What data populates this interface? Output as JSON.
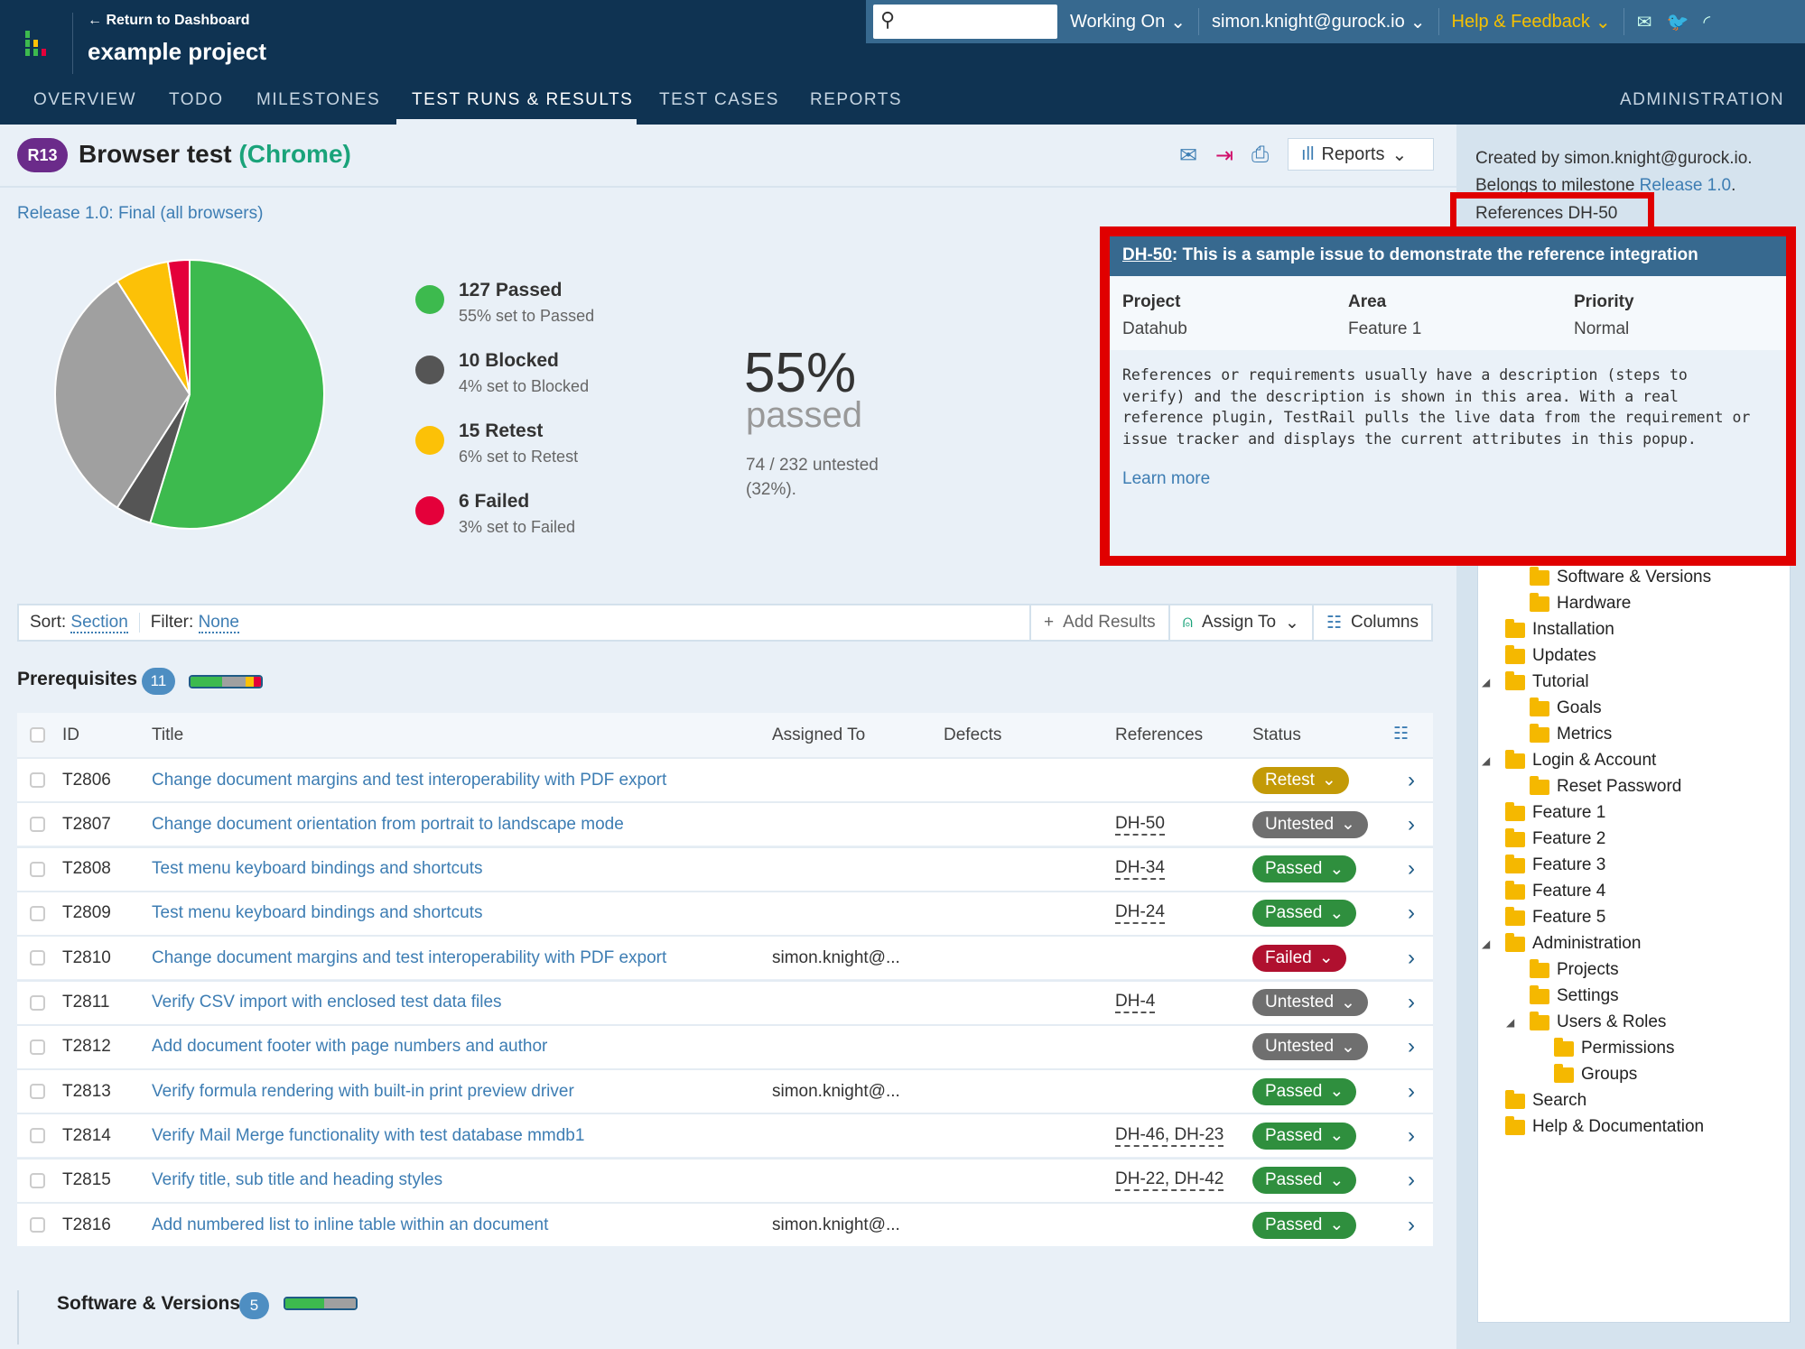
{
  "header": {
    "return_link": "← Return to Dashboard",
    "project": "example project",
    "search_placeholder": "",
    "working_on": "Working On",
    "user": "simon.knight@gurock.io",
    "help": "Help & Feedback"
  },
  "nav": {
    "tabs": [
      "OVERVIEW",
      "TODO",
      "MILESTONES",
      "TEST RUNS & RESULTS",
      "TEST CASES",
      "REPORTS"
    ],
    "active": "TEST RUNS & RESULTS",
    "admin": "ADMINISTRATION"
  },
  "run": {
    "badge": "R13",
    "title": "Browser test",
    "config": "(Chrome)",
    "milestone_link": "Release 1.0: Final (all browsers)",
    "reports_label": "Reports"
  },
  "stats": {
    "items": [
      {
        "title": "127 Passed",
        "sub": "55% set to Passed",
        "color": "#3dba4e",
        "value": 127
      },
      {
        "title": "10 Blocked",
        "sub": "4% set to Blocked",
        "color": "#555555",
        "value": 10
      },
      {
        "title": "15 Retest",
        "sub": "6% set to Retest",
        "color": "#fcc107",
        "value": 15
      },
      {
        "title": "6 Failed",
        "sub": "3% set to Failed",
        "color": "#e4003a",
        "value": 6
      }
    ],
    "untested_value": 74,
    "untested_color": "#a0a0a0",
    "percent": "55%",
    "percent_label": "passed",
    "untested": "74 / 232 untested",
    "untested_pct": "(32%)."
  },
  "toolbar": {
    "sort_label": "Sort:",
    "sort_value": "Section",
    "filter_label": "Filter:",
    "filter_value": "None",
    "add_results": "Add Results",
    "assign_to": "Assign To",
    "columns": "Columns"
  },
  "section": {
    "name": "Prerequisites",
    "count": "11",
    "next_name": "Software & Versions",
    "next_count": "5"
  },
  "table": {
    "headers": [
      "ID",
      "Title",
      "Assigned To",
      "Defects",
      "References",
      "Status"
    ],
    "rows": [
      {
        "id": "T2806",
        "title": "Change document margins and test interoperability with PDF export",
        "assigned": "",
        "refs": "",
        "status": "Retest"
      },
      {
        "id": "T2807",
        "title": "Change document orientation from portrait to landscape mode",
        "assigned": "",
        "refs": "DH-50",
        "status": "Untested"
      },
      {
        "id": "T2808",
        "title": "Test menu keyboard bindings and shortcuts",
        "assigned": "",
        "refs": "DH-34",
        "status": "Passed"
      },
      {
        "id": "T2809",
        "title": "Test menu keyboard bindings and shortcuts",
        "assigned": "",
        "refs": "DH-24",
        "status": "Passed"
      },
      {
        "id": "T2810",
        "title": "Change document margins and test interoperability with PDF export",
        "assigned": "simon.knight@...",
        "refs": "",
        "status": "Failed"
      },
      {
        "id": "T2811",
        "title": "Verify CSV import with enclosed test data files",
        "assigned": "",
        "refs": "DH-4",
        "status": "Untested"
      },
      {
        "id": "T2812",
        "title": "Add document footer with page numbers and author",
        "assigned": "",
        "refs": "",
        "status": "Untested"
      },
      {
        "id": "T2813",
        "title": "Verify formula rendering with built-in print preview driver",
        "assigned": "simon.knight@...",
        "refs": "",
        "status": "Passed"
      },
      {
        "id": "T2814",
        "title": "Verify Mail Merge functionality with test database mmdb1",
        "assigned": "",
        "refs": "DH-46, DH-23",
        "status": "Passed"
      },
      {
        "id": "T2815",
        "title": "Verify title, sub title and heading styles",
        "assigned": "",
        "refs": "DH-22, DH-42",
        "status": "Passed"
      },
      {
        "id": "T2816",
        "title": "Add numbered list to inline table within an document",
        "assigned": "simon.knight@...",
        "refs": "",
        "status": "Passed"
      }
    ]
  },
  "status_colors": {
    "Retest": "#c39a07",
    "Untested": "#6f6f6f",
    "Passed": "#2f8f3e",
    "Failed": "#b0102f"
  },
  "sidebar": {
    "created_by": "Created by simon.knight@gurock.io.",
    "belongs": "Belongs to milestone ",
    "milestone": "Release 1.0",
    "references": "References DH-50",
    "tree": [
      {
        "l": 2,
        "t": "Software & Versions"
      },
      {
        "l": 2,
        "t": "Hardware"
      },
      {
        "l": 1,
        "t": "Installation"
      },
      {
        "l": 1,
        "t": "Updates"
      },
      {
        "l": 1,
        "t": "Tutorial",
        "e": true
      },
      {
        "l": 2,
        "t": "Goals"
      },
      {
        "l": 2,
        "t": "Metrics"
      },
      {
        "l": 1,
        "t": "Login & Account",
        "e": true
      },
      {
        "l": 2,
        "t": "Reset Password"
      },
      {
        "l": 1,
        "t": "Feature 1"
      },
      {
        "l": 1,
        "t": "Feature 2"
      },
      {
        "l": 1,
        "t": "Feature 3"
      },
      {
        "l": 1,
        "t": "Feature 4"
      },
      {
        "l": 1,
        "t": "Feature 5"
      },
      {
        "l": 1,
        "t": "Administration",
        "e": true
      },
      {
        "l": 2,
        "t": "Projects"
      },
      {
        "l": 2,
        "t": "Settings"
      },
      {
        "l": 2,
        "t": "Users & Roles",
        "e": true
      },
      {
        "l": 3,
        "t": "Permissions"
      },
      {
        "l": 3,
        "t": "Groups"
      },
      {
        "l": 1,
        "t": "Search"
      },
      {
        "l": 1,
        "t": "Help & Documentation"
      }
    ]
  },
  "popup": {
    "key": "DH-50",
    "summary": ": This is a sample issue to demonstrate the reference integration",
    "fields": [
      {
        "label": "Project",
        "value": "Datahub"
      },
      {
        "label": "Area",
        "value": "Feature 1"
      },
      {
        "label": "Priority",
        "value": "Normal"
      }
    ],
    "description": "References or requirements usually have a description (steps to verify) and the description is shown in this area. With a real reference plugin, TestRail pulls the live data from the requirement or issue tracker and displays the current attributes in this popup.",
    "learn_more": "Learn more",
    "highlight_color": "#e00000"
  }
}
